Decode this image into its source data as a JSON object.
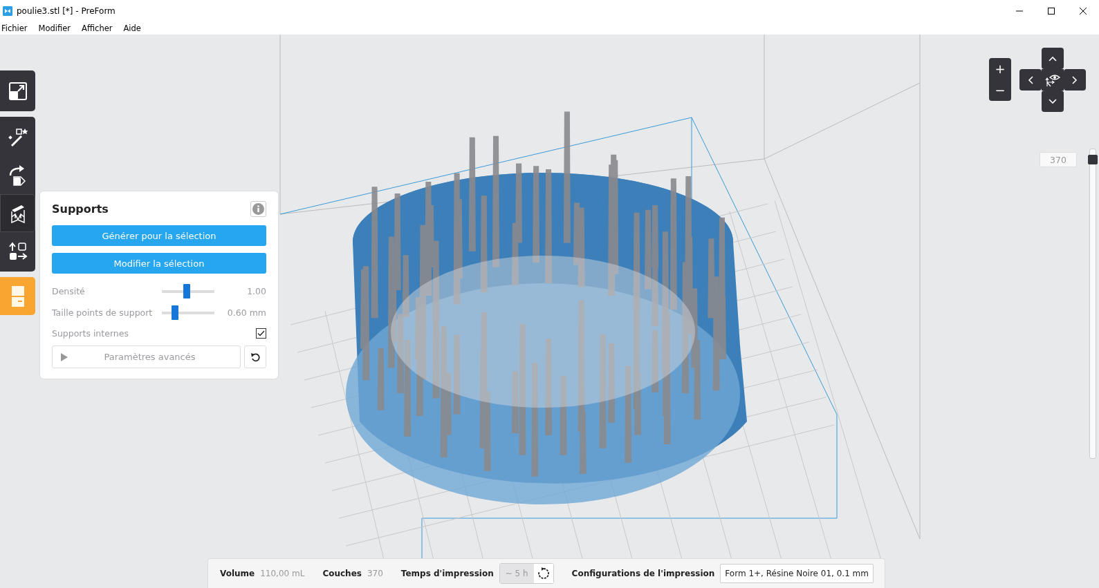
{
  "window": {
    "title": "poulie3.stl [*] - PreForm"
  },
  "menu": [
    "Fichier",
    "Modifier",
    "Afficher",
    "Aide"
  ],
  "tools": [
    {
      "kind": "scale",
      "selected": false
    },
    {
      "kind": "magic",
      "selected": false
    },
    {
      "kind": "orient",
      "selected": false
    },
    {
      "kind": "supports",
      "selected": true
    },
    {
      "kind": "layout",
      "selected": false
    },
    {
      "kind": "print",
      "selected": false
    }
  ],
  "panel": {
    "title": "Supports",
    "buttons": [
      "Générer pour la sélection",
      "Modifier la sélection"
    ],
    "sliders": [
      {
        "label": "Densité",
        "level": 0.47,
        "reading": "1.00"
      },
      {
        "label": "Taille points de support",
        "level": 0.25,
        "reading": "0.60 mm"
      }
    ],
    "internal": {
      "label": "Supports internes",
      "checked": true
    },
    "advanced": {
      "label": "Paramètres avancés",
      "expanded": false
    }
  },
  "zoom": [
    "+",
    "−"
  ],
  "layer": {
    "reading": "370",
    "level": 1
  },
  "status": {
    "volume_label": "Volume",
    "volume": "110,00 mL",
    "layers_label": "Couches",
    "layers": "370",
    "time_label": "Temps d'impression",
    "time": "~ 5 h",
    "config_label": "Configurations de l'impression",
    "config": "Form 1+, Résine Noire 01, 0.1 mm"
  }
}
